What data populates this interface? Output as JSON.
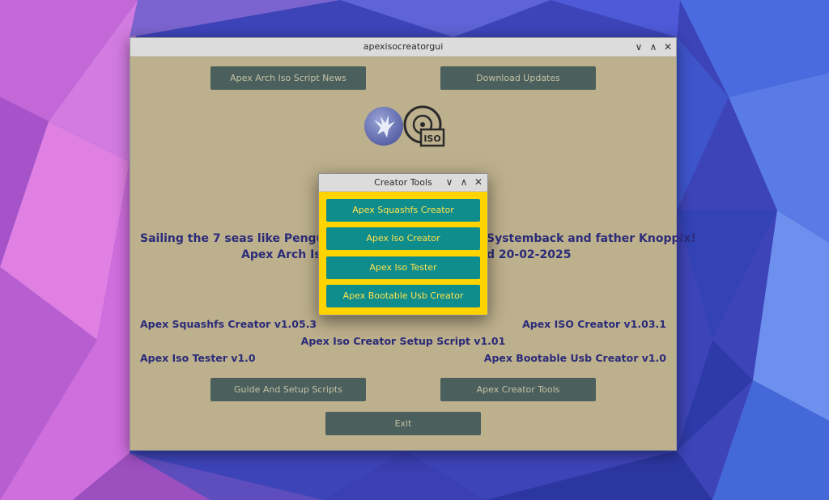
{
  "main_window": {
    "title": "apexisocreatorgui",
    "controls": {
      "minimize": "∨",
      "maximize": "∧",
      "close": "✕"
    },
    "top_buttons": {
      "news": "Apex Arch Iso Script News",
      "updates": "Download Updates"
    },
    "banner": {
      "line1_left": "Sailing the 7 seas like Penguin's",
      "line1_right": "Systemback and father Knoppix!",
      "line2_left": "Apex Arch Is",
      "line2_right": "d 20-02-2025"
    },
    "versions": {
      "squashfs": "Apex Squashfs Creator v1.05.3",
      "iso_creator": "Apex ISO Creator v1.03.1",
      "setup_script": "Apex Iso Creator Setup Script v1.01",
      "iso_tester": "Apex Iso Tester v1.0",
      "usb_creator": "Apex Bootable Usb Creator v1.0"
    },
    "bottom_buttons": {
      "guide": "Guide And Setup Scripts",
      "creator_tools": "Apex Creator Tools",
      "exit": "Exit"
    },
    "logo": {
      "iso_text": "ISO"
    }
  },
  "dialog": {
    "title": "Creator Tools",
    "controls": {
      "minimize": "∨",
      "maximize": "∧",
      "close": "✕"
    },
    "buttons": [
      "Apex Squashfs Creator",
      "Apex Iso Creator",
      "Apex Iso Tester",
      "Apex Bootable Usb Creator"
    ]
  },
  "colors": {
    "window_bg": "#bdb08c",
    "button_bg": "#4b5f5d",
    "dialog_bg": "#ffd400",
    "dialog_button_bg": "#0f8c8c",
    "dialog_button_text": "#ffe44c",
    "label_text": "#2b2b7a"
  }
}
